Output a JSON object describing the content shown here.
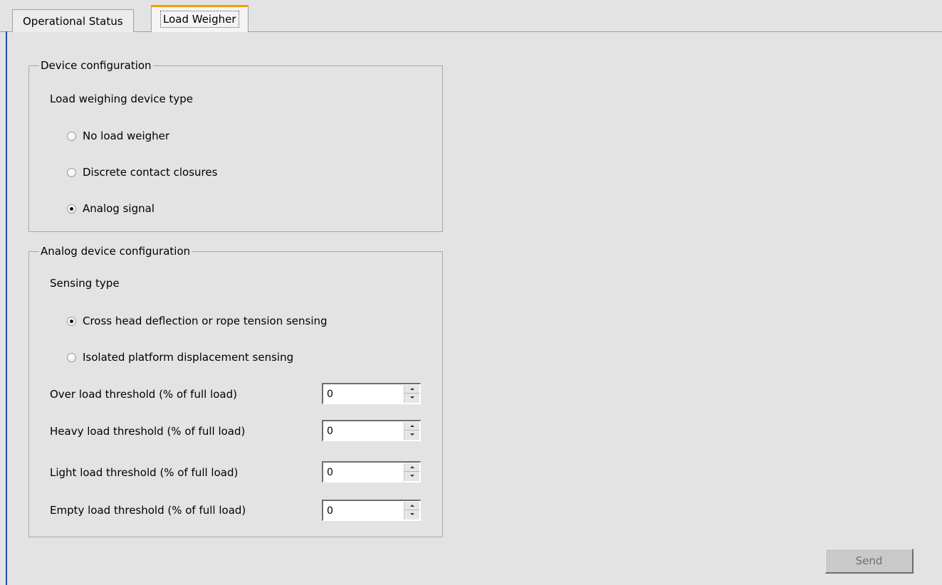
{
  "tabs": [
    {
      "label": "Operational Status",
      "active": false
    },
    {
      "label": "Load Weigher",
      "active": true
    }
  ],
  "device_config": {
    "legend": "Device configuration",
    "prompt": "Load weighing device type",
    "options": [
      {
        "label": "No load weigher",
        "checked": false
      },
      {
        "label": "Discrete contact closures",
        "checked": false
      },
      {
        "label": "Analog signal",
        "checked": true
      }
    ]
  },
  "analog_config": {
    "legend": "Analog device configuration",
    "sensing_prompt": "Sensing type",
    "sensing_options": [
      {
        "label": "Cross head deflection or rope tension sensing",
        "checked": true
      },
      {
        "label": "Isolated platform displacement sensing",
        "checked": false
      }
    ],
    "thresholds": [
      {
        "label": "Over load threshold (% of full load)",
        "value": "0"
      },
      {
        "label": "Heavy load threshold (% of full load)",
        "value": "0"
      },
      {
        "label": "Light load threshold (% of full load)",
        "value": "0"
      },
      {
        "label": "Empty load threshold (% of full load)",
        "value": "0"
      }
    ]
  },
  "actions": {
    "send_label": "Send",
    "send_enabled": false
  },
  "colors": {
    "panel_background": "#e3e3e3",
    "active_tab_accent": "#f0a000",
    "left_edge_accent": "#1e4fa8"
  }
}
